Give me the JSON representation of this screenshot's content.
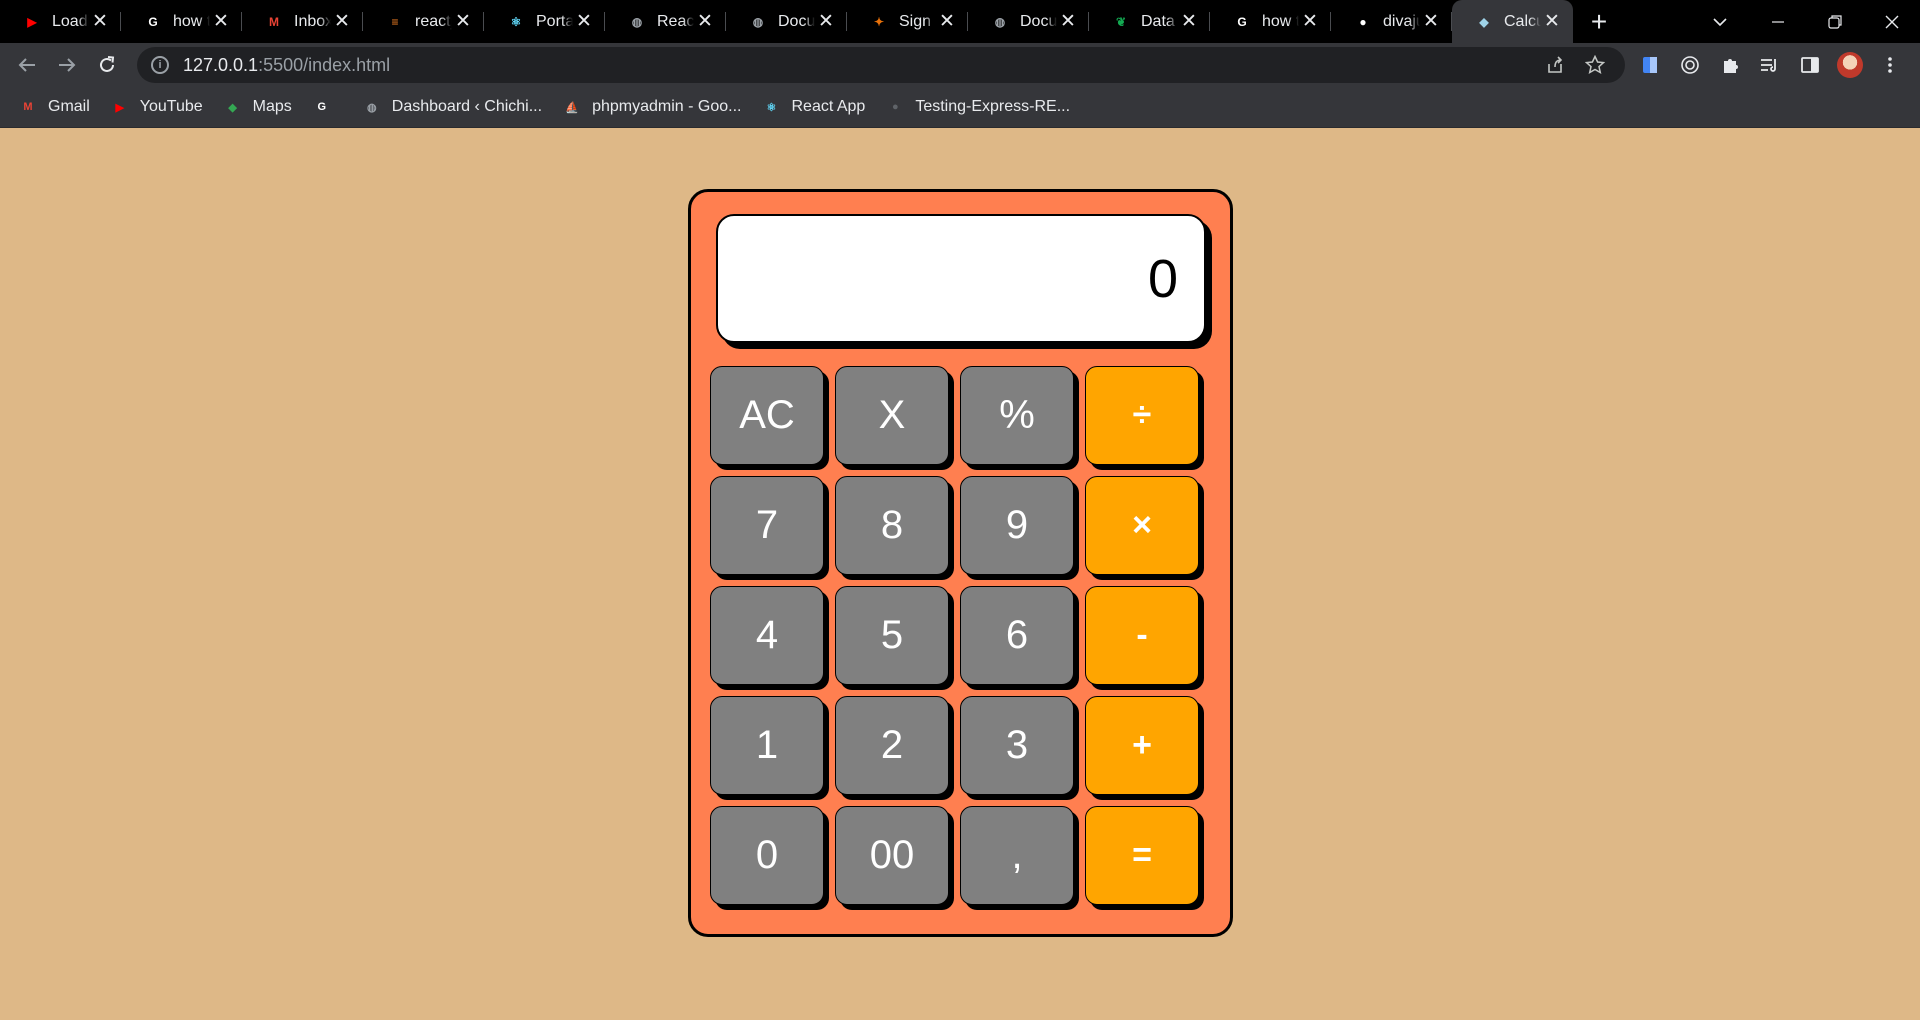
{
  "browser": {
    "tabs": [
      {
        "title": "Loading...",
        "icon": "youtube-icon",
        "color": "#ff0000",
        "glyph": "▶"
      },
      {
        "title": "how to",
        "icon": "google-icon",
        "color": "#ffffff",
        "glyph": "G"
      },
      {
        "title": "Inbox",
        "icon": "gmail-icon",
        "color": "#ea4335",
        "glyph": "M"
      },
      {
        "title": "reactjs",
        "icon": "stackoverflow-icon",
        "color": "#f48024",
        "glyph": "≡"
      },
      {
        "title": "Portal",
        "icon": "react-icon",
        "color": "#61dafb",
        "glyph": "⚛"
      },
      {
        "title": "React",
        "icon": "globe-icon",
        "color": "#9aa0a6",
        "glyph": "◍"
      },
      {
        "title": "Docum",
        "icon": "globe-icon",
        "color": "#9aa0a6",
        "glyph": "◍"
      },
      {
        "title": "Sign Up",
        "icon": "fox-icon",
        "color": "#e8710a",
        "glyph": "✦"
      },
      {
        "title": "Docum",
        "icon": "globe-icon",
        "color": "#9aa0a6",
        "glyph": "◍"
      },
      {
        "title": "Data |",
        "icon": "mongodb-icon",
        "color": "#13aa52",
        "glyph": "❦"
      },
      {
        "title": "how t",
        "icon": "google-icon",
        "color": "#ffffff",
        "glyph": "G"
      },
      {
        "title": "divaju",
        "icon": "github-icon",
        "color": "#ffffff",
        "glyph": "●"
      },
      {
        "title": "Calcul",
        "icon": "calculator-tab-icon",
        "color": "#9fd3e8",
        "glyph": "◆",
        "active": true
      }
    ],
    "close_glyph": "✕",
    "new_tab_glyph": "+",
    "url_host": "127.0.0.1",
    "url_path": ":5500/index.html",
    "bookmarks": [
      {
        "label": "Gmail",
        "icon": "gmail-icon",
        "color": "#ea4335",
        "glyph": "M"
      },
      {
        "label": "YouTube",
        "icon": "youtube-icon",
        "color": "#ff0000",
        "glyph": "▶"
      },
      {
        "label": "Maps",
        "icon": "maps-icon",
        "color": "#34a853",
        "glyph": "◆"
      },
      {
        "label": "",
        "icon": "google-icon",
        "color": "#ffffff",
        "glyph": "G"
      },
      {
        "label": "Dashboard ‹ Chichi...",
        "icon": "globe-icon",
        "color": "#9aa0a6",
        "glyph": "◍"
      },
      {
        "label": "phpmyadmin - Goo...",
        "icon": "phpmyadmin-icon",
        "color": "#f29111",
        "glyph": "⛵"
      },
      {
        "label": "React App",
        "icon": "react-icon",
        "color": "#61dafb",
        "glyph": "⚛"
      },
      {
        "label": "Testing-Express-RE...",
        "icon": "github-icon",
        "color": "#5f6368",
        "glyph": "●"
      }
    ]
  },
  "calculator": {
    "display": "0",
    "keys": [
      [
        "AC",
        "X",
        "%",
        "÷"
      ],
      [
        "7",
        "8",
        "9",
        "×"
      ],
      [
        "4",
        "5",
        "6",
        "-"
      ],
      [
        "1",
        "2",
        "3",
        "+"
      ],
      [
        "0",
        "00",
        ",",
        "="
      ]
    ],
    "key_names": [
      [
        "clear-key",
        "backspace-key",
        "percent-key",
        "divide-key"
      ],
      [
        "digit-7-key",
        "digit-8-key",
        "digit-9-key",
        "multiply-key"
      ],
      [
        "digit-4-key",
        "digit-5-key",
        "digit-6-key",
        "subtract-key"
      ],
      [
        "digit-1-key",
        "digit-2-key",
        "digit-3-key",
        "add-key"
      ],
      [
        "digit-0-key",
        "double-zero-key",
        "decimal-key",
        "equals-key"
      ]
    ],
    "colors": {
      "page_background": "#deb887",
      "body": "#ff7f50",
      "number_key": "#808080",
      "operator_key": "#ffa500",
      "display": "#ffffff"
    }
  }
}
